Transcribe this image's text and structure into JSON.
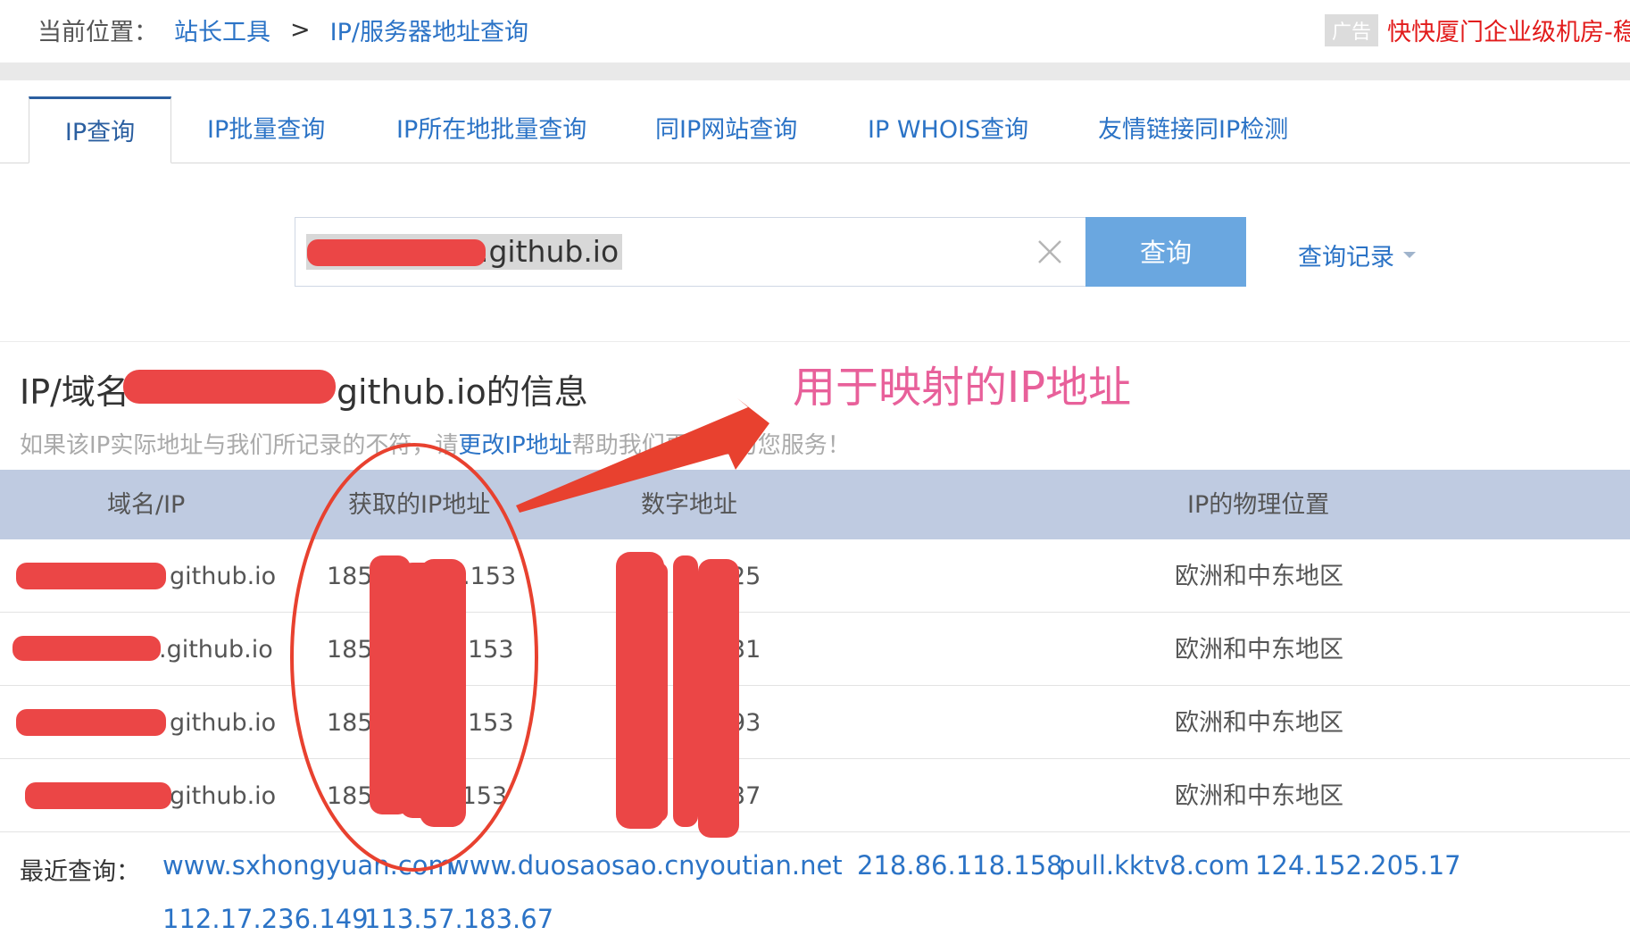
{
  "breadcrumb": {
    "label": "当前位置：",
    "root": "站长工具",
    "separator": ">",
    "current": "IP/服务器地址查询"
  },
  "ad": {
    "tag": "广告",
    "text": "快快厦门企业级机房-稳定"
  },
  "tabs": [
    {
      "label": "IP查询",
      "active": true
    },
    {
      "label": "IP批量查询",
      "active": false
    },
    {
      "label": "IP所在地批量查询",
      "active": false
    },
    {
      "label": "同IP网站查询",
      "active": false
    },
    {
      "label": "IP WHOIS查询",
      "active": false
    },
    {
      "label": "友情链接同IP检测",
      "active": false
    }
  ],
  "search": {
    "value": ".github.io",
    "button": "查询",
    "history": "查询记录"
  },
  "result": {
    "title_prefix": "IP/域名",
    "title_suffix": "github.io的信息",
    "hint_before": "如果该IP实际地址与我们所记录的不符，请",
    "hint_link": "更改IP地址",
    "hint_after": "帮助我们更好的为您服务！"
  },
  "table": {
    "headers": [
      "域名/IP",
      "获取的IP地址",
      "数字地址",
      "IP的物理位置"
    ],
    "rows": [
      {
        "domain": "github.io",
        "ip_prefix": "185",
        "ip_suffix": ".153",
        "num_suffix": "25",
        "location": "欧洲和中东地区"
      },
      {
        "domain": ".github.io",
        "ip_prefix": "185",
        "ip_suffix": "153",
        "num_suffix": "31",
        "location": "欧洲和中东地区"
      },
      {
        "domain": "github.io",
        "ip_prefix": "185",
        "ip_suffix": "153",
        "num_suffix": "93",
        "location": "欧洲和中东地区"
      },
      {
        "domain": "github.io",
        "ip_prefix": "185",
        "ip_suffix": ".153",
        "num_suffix": "37",
        "location": "欧洲和中东地区"
      }
    ]
  },
  "recent": {
    "label": "最近查询：",
    "links": [
      "www.sxhongyuan.com",
      "www.duosaosao.cn",
      "youtian.net",
      "218.86.118.158",
      "pull.kktv8.com",
      "124.152.205.17",
      "112.17.236.149",
      "113.57.183.67"
    ]
  },
  "annotation": {
    "text": "用于映射的IP地址",
    "color": "#e8609a",
    "arrow_color": "#e8412f",
    "redaction_color": "#eb4646"
  },
  "colors": {
    "link": "#2b73c6",
    "button": "#6aa7e0",
    "table_header": "#bfcbe1"
  }
}
